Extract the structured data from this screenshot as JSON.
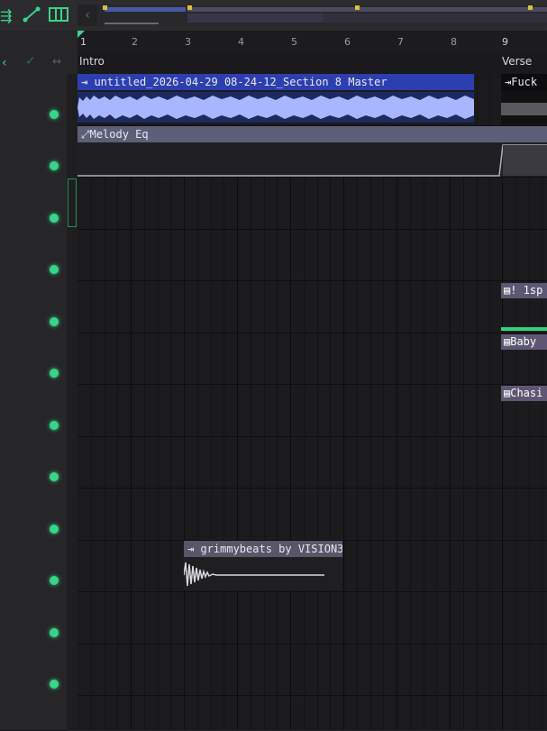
{
  "ruler": {
    "bars": [
      "1",
      "2",
      "3",
      "4",
      "5",
      "6",
      "7",
      "8",
      "9"
    ]
  },
  "markers": {
    "intro": "Intro",
    "verse": "Verse"
  },
  "clips": {
    "master": "untitled_2026-04-29 08-24-12_Section 8 Master",
    "master_continued": "Fuck",
    "automation": "Melody Eq",
    "pattern_1": "! 1sp",
    "pattern_2": "Baby",
    "pattern_3": "Chasi",
    "sample": "grimmybeats by VISION3"
  },
  "colors": {
    "accent": "#39d489",
    "audio_clip": "#2d3fb0",
    "pattern_clip": "#5e5773",
    "automation_clip": "#5d5f78"
  },
  "icons": [
    "playlist-icon",
    "automation-icon",
    "piano-icon",
    "back-icon",
    "check-icon",
    "arrows-icon"
  ]
}
